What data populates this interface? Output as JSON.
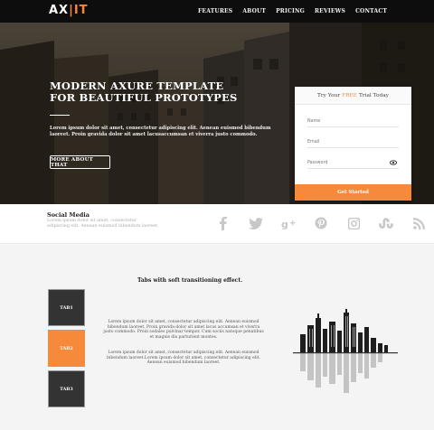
{
  "nav": {
    "logo": {
      "left": "AX",
      "right": "IT"
    },
    "links": [
      "FEATURES",
      "ABOUT",
      "PRICING",
      "REVIEWS",
      "CONTACT"
    ]
  },
  "hero": {
    "title_line1": "MODERN AXURE TEMPLATE",
    "title_line2": "FOR BEAUTIFUL PROTOTYPES",
    "body": "Lorem ipsum dolor sit amet, consectetur adipiscing elit. Aenean euismod bibendum laoreet. Proin gravida dolor sit amet lacusaccumsan et viverra justo commodo.",
    "button": "MORE ABOUT THAT"
  },
  "signup": {
    "head_prefix": "Try Your",
    "head_free": "FREE",
    "head_suffix": "Trial Today",
    "name_placeholder": "Name",
    "email_placeholder": "Email",
    "password_placeholder": "Password",
    "button": "Get Started"
  },
  "social": {
    "title": "Social Media",
    "desc": "Lorem ipsum dolor sit amet, consectetur adipiscing elit. Aenean euismod bibendum laoreet.",
    "icons": [
      "facebook-icon",
      "twitter-icon",
      "google-plus-icon",
      "pinterest-icon",
      "instagram-icon",
      "stumbleupon-icon",
      "rss-icon"
    ]
  },
  "tabs": {
    "title": "Tabs with soft transitioning effect.",
    "labels": [
      "TAB1",
      "TAB2",
      "TAB3"
    ],
    "para1": "Lorem ipsum dolor sit amet, consectetur adipiscing elit. Aenean euismod bibendum laoreet. Proin gravida dolor sit amet lacus accumsan et viverra justo commodo. Proin sodales pulvinar tempor. Cum sociis natoque penatibus et magnis dis parturient montes.",
    "para2": "Lorem ipsum dolor sit amet, consectetur adipiscing elit. Aenean euismod bibendum laoreet.Lorem ipsum dolor sit amet, consectetur adipiscing elit. Aenean euismod bibendum laoreet."
  },
  "colors": {
    "accent": "#f7893b",
    "nav_bg": "#0d0d0d",
    "icon": "#c8c8c8"
  }
}
